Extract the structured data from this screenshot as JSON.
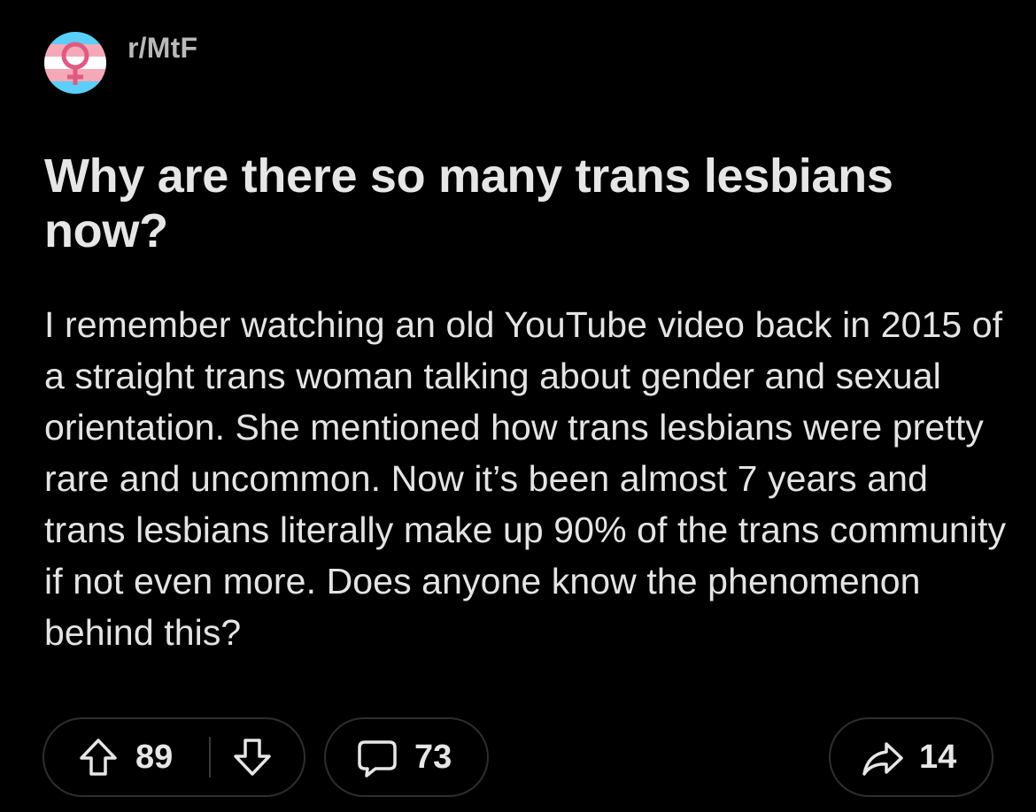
{
  "post": {
    "subreddit": "r/MtF",
    "title": "Why are there so many trans lesbians now?",
    "body": "I remember watching an old YouTube video back in 2015 of a straight trans woman talking about gender and sexual orientation. She mentioned how trans lesbians were pretty rare and uncommon. Now it’s been almost 7 years and trans lesbians literally make up 90% of the trans community if not even more. Does anyone know the phenomenon behind this?"
  },
  "actions": {
    "upvotes": "89",
    "comments": "73",
    "shares": "14"
  },
  "icons": {
    "avatar": "trans-flag-female-symbol-icon",
    "upvote": "arrow-up-icon",
    "downvote": "arrow-down-icon",
    "comment": "speech-bubble-icon",
    "share": "share-arrow-icon"
  },
  "colors": {
    "background": "#000000",
    "flag_blue": "#5BCEFA",
    "flag_pink": "#F5A9B8",
    "flag_white": "#FFFFFF",
    "symbol": "#E05A80"
  }
}
